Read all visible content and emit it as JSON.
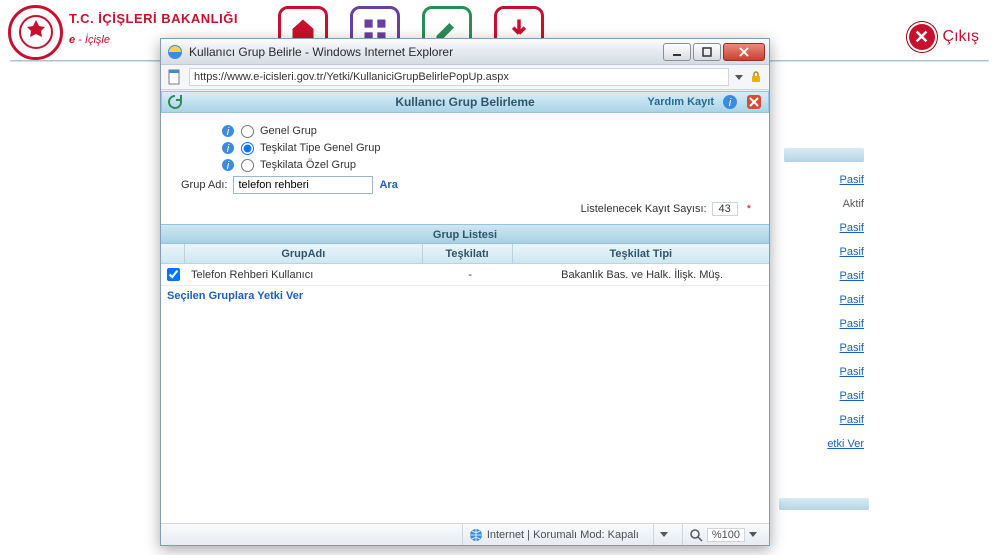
{
  "bg": {
    "ministry": "T.C. İÇİŞLERİ BAKANLIĞI",
    "app_name_prefix": "e",
    "app_name": " - İçişle",
    "exit_label": "Çıkış",
    "status_links": [
      "Pasif",
      "Aktif",
      "Pasif",
      "Pasif",
      "Pasif",
      "Pasif",
      "Pasif",
      "Pasif",
      "Pasif",
      "Pasif",
      "Pasif"
    ],
    "grant_link": "etki Ver"
  },
  "popup": {
    "window_title": "Kullanıcı Grup Belirle - Windows Internet Explorer",
    "url": "https://www.e-icisleri.gov.tr/Yetki/KullaniciGrupBelirlePopUp.aspx",
    "page_title": "Kullanıcı Grup Belirleme",
    "help_label": "Yardım Kayıt",
    "radios": {
      "general": "Genel Grup",
      "by_type": "Teşkilat Tipe Genel Grup",
      "by_org": "Teşkilata Özel Grup"
    },
    "selected_radio": "by_type",
    "group_name_label": "Grup Adı:",
    "group_name_value": "telefon rehberi",
    "search_label": "Ara",
    "count_label": "Listelenecek Kayıt Sayısı:",
    "count_value": "43",
    "list_title": "Grup Listesi",
    "columns": {
      "name": "GrupAdı",
      "org": "Teşkilatı",
      "type": "Teşkilat Tipi"
    },
    "rows": [
      {
        "checked": true,
        "name": "Telefon Rehberi Kullanıcı",
        "org": "-",
        "type": "Bakanlık Bas. ve Halk. İlişk. Müş."
      }
    ],
    "grant_label": "Seçilen Gruplara Yetki Ver",
    "status": {
      "mode": "Internet | Korumalı Mod: Kapalı",
      "zoom": "%100"
    }
  },
  "colors": {
    "brand_red": "#c8102e",
    "link_blue": "#1b5fbd",
    "header_text": "#2f566a"
  }
}
